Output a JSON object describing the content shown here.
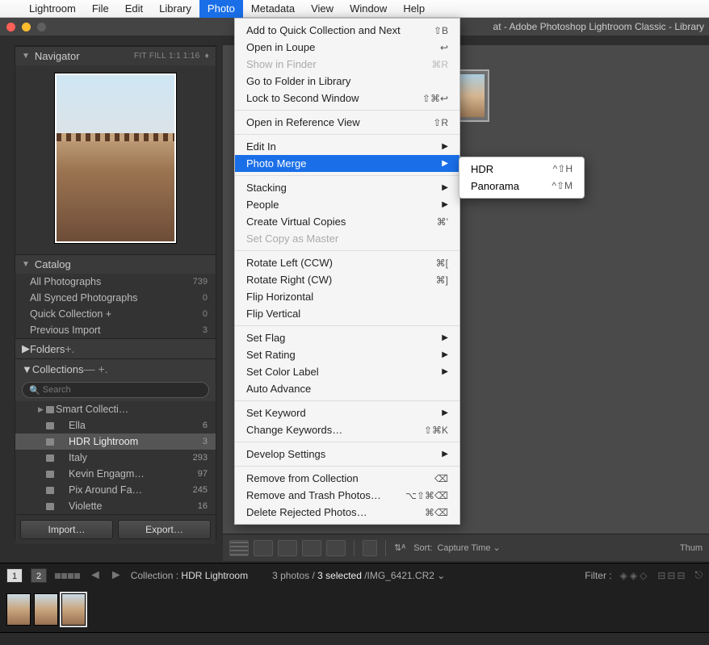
{
  "menubar": {
    "items": [
      "Lightroom",
      "File",
      "Edit",
      "Library",
      "Photo",
      "Metadata",
      "View",
      "Window",
      "Help"
    ],
    "active": "Photo"
  },
  "title_suffix": "at - Adobe Photoshop Lightroom Classic - Library",
  "navigator": {
    "label": "Navigator",
    "modes": [
      "FIT",
      "FILL",
      "1:1",
      "1:16"
    ]
  },
  "catalog": {
    "label": "Catalog",
    "rows": [
      {
        "name": "All Photographs",
        "count": "739"
      },
      {
        "name": "All Synced Photographs",
        "count": "0"
      },
      {
        "name": "Quick Collection  +",
        "count": "0"
      },
      {
        "name": "Previous Import",
        "count": "3"
      }
    ]
  },
  "folders": {
    "label": "Folders"
  },
  "collections": {
    "label": "Collections",
    "search_placeholder": "Search",
    "items": [
      {
        "name": "Smart Collecti…",
        "count": "",
        "tri": "▶"
      },
      {
        "name": "Ella",
        "count": "6"
      },
      {
        "name": "HDR Lightroom",
        "count": "3",
        "selected": true
      },
      {
        "name": "Italy",
        "count": "293"
      },
      {
        "name": "Kevin Engagm…",
        "count": "97"
      },
      {
        "name": "Pix Around Fa…",
        "count": "245"
      },
      {
        "name": "Violette",
        "count": "16"
      }
    ]
  },
  "buttons": {
    "import": "Import…",
    "export": "Export…"
  },
  "toolbar": {
    "sort_label": "Sort:",
    "sort_value": "Capture Time",
    "thumb_label": "Thum"
  },
  "status": {
    "pages": [
      "1",
      "2"
    ],
    "collection_prefix": "Collection :",
    "collection_name": "HDR Lightroom",
    "photos": "3 photos /",
    "selected": "3 selected",
    "file": "/IMG_6421.CR2",
    "filter": "Filter :"
  },
  "photo_menu": [
    {
      "t": "Add to Quick Collection and Next",
      "s": "⇧B"
    },
    {
      "t": "Open in Loupe",
      "s": "↩"
    },
    {
      "t": "Show in Finder",
      "s": "⌘R",
      "dis": true
    },
    {
      "t": "Go to Folder in Library"
    },
    {
      "t": "Lock to Second Window",
      "s": "⇧⌘↩"
    },
    {
      "hr": true
    },
    {
      "t": "Open in Reference View",
      "s": "⇧R"
    },
    {
      "hr": true
    },
    {
      "t": "Edit In",
      "sub": true
    },
    {
      "t": "Photo Merge",
      "sub": true,
      "hi": true
    },
    {
      "hr": true
    },
    {
      "t": "Stacking",
      "sub": true
    },
    {
      "t": "People",
      "sub": true
    },
    {
      "t": "Create Virtual Copies",
      "s": "⌘'"
    },
    {
      "t": "Set Copy as Master",
      "dis": true
    },
    {
      "hr": true
    },
    {
      "t": "Rotate Left (CCW)",
      "s": "⌘["
    },
    {
      "t": "Rotate Right (CW)",
      "s": "⌘]"
    },
    {
      "t": "Flip Horizontal"
    },
    {
      "t": "Flip Vertical"
    },
    {
      "hr": true
    },
    {
      "t": "Set Flag",
      "sub": true
    },
    {
      "t": "Set Rating",
      "sub": true
    },
    {
      "t": "Set Color Label",
      "sub": true
    },
    {
      "t": "Auto Advance"
    },
    {
      "hr": true
    },
    {
      "t": "Set Keyword",
      "sub": true
    },
    {
      "t": "Change Keywords…",
      "s": "⇧⌘K"
    },
    {
      "hr": true
    },
    {
      "t": "Develop Settings",
      "sub": true
    },
    {
      "hr": true
    },
    {
      "t": "Remove from Collection",
      "s": "⌫"
    },
    {
      "t": "Remove and Trash Photos…",
      "s": "⌥⇧⌘⌫"
    },
    {
      "t": "Delete Rejected Photos…",
      "s": "⌘⌫"
    }
  ],
  "submenu": [
    {
      "t": "HDR",
      "s": "^⇧H"
    },
    {
      "t": "Panorama",
      "s": "^⇧M"
    }
  ]
}
